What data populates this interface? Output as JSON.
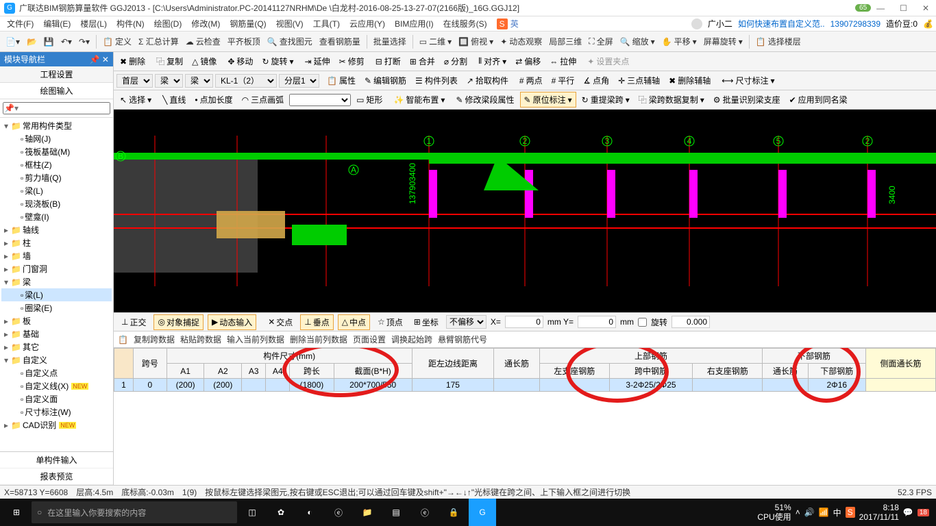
{
  "title": "广联达BIM钢筋算量软件 GGJ2013 - [C:\\Users\\Administrator.PC-20141127NRHM\\De     \\白龙村-2016-08-25-13-27-07(2166版)_16G.GGJ12]",
  "title_badge": "65",
  "win": {
    "min": "—",
    "max": "☐",
    "close": "✕"
  },
  "menu": [
    "文件(F)",
    "编辑(E)",
    "楼层(L)",
    "构件(N)",
    "绘图(D)",
    "修改(M)",
    "钢筋量(Q)",
    "视图(V)",
    "工具(T)",
    "云应用(Y)",
    "BIM应用(I)",
    "在线服务(S)"
  ],
  "menu_right": {
    "user": "广小二",
    "help_link": "如何快速布置自定义范..",
    "phone": "13907298339",
    "coin_label": "造价豆:0"
  },
  "toolbar1": [
    "定义",
    "Σ 汇总计算",
    "云检查",
    "平齐板顶",
    "查找图元",
    "查看钢筋量",
    "批量选择",
    "二维",
    "俯视",
    "动态观察",
    "局部三维",
    "全屏",
    "缩放",
    "平移",
    "屏幕旋转",
    "选择楼层"
  ],
  "toolbar_edit": [
    "删除",
    "复制",
    "镜像",
    "移动",
    "旋转",
    "延伸",
    "修剪",
    "打断",
    "合并",
    "分割",
    "对齐",
    "偏移",
    "拉伸",
    "设置夹点"
  ],
  "combos": {
    "floor": "首层",
    "type": "梁",
    "subtype": "梁",
    "member": "KL-1（2）",
    "layer": "分层1"
  },
  "toolbar_member": [
    "属性",
    "编辑钢筋",
    "构件列表",
    "拾取构件",
    "两点",
    "平行",
    "点角",
    "三点辅轴",
    "删除辅轴",
    "尺寸标注"
  ],
  "toolbar_draw": [
    "选择",
    "直线",
    "点加长度",
    "三点画弧",
    "矩形",
    "智能布置",
    "修改梁段属性",
    "原位标注",
    "重提梁跨",
    "梁跨数据复制",
    "批量识别梁支座",
    "应用到同名梁"
  ],
  "sidebar": {
    "title": "模块导航栏",
    "tabs": [
      "工程设置",
      "绘图输入"
    ],
    "nodes": [
      {
        "label": "常用构件类型",
        "lvl": 0,
        "exp": "-",
        "folder": true
      },
      {
        "label": "轴网(J)",
        "lvl": 1
      },
      {
        "label": "筏板基础(M)",
        "lvl": 1
      },
      {
        "label": "框柱(Z)",
        "lvl": 1
      },
      {
        "label": "剪力墙(Q)",
        "lvl": 1
      },
      {
        "label": "梁(L)",
        "lvl": 1
      },
      {
        "label": "现浇板(B)",
        "lvl": 1
      },
      {
        "label": "壁龛(I)",
        "lvl": 1
      },
      {
        "label": "轴线",
        "lvl": 0,
        "exp": "+",
        "folder": true
      },
      {
        "label": "柱",
        "lvl": 0,
        "exp": "+",
        "folder": true
      },
      {
        "label": "墙",
        "lvl": 0,
        "exp": "+",
        "folder": true
      },
      {
        "label": "门窗洞",
        "lvl": 0,
        "exp": "+",
        "folder": true
      },
      {
        "label": "梁",
        "lvl": 0,
        "exp": "-",
        "folder": true
      },
      {
        "label": "梁(L)",
        "lvl": 1,
        "selected": true
      },
      {
        "label": "圈梁(E)",
        "lvl": 1
      },
      {
        "label": "板",
        "lvl": 0,
        "exp": "+",
        "folder": true
      },
      {
        "label": "基础",
        "lvl": 0,
        "exp": "+",
        "folder": true
      },
      {
        "label": "其它",
        "lvl": 0,
        "exp": "+",
        "folder": true
      },
      {
        "label": "自定义",
        "lvl": 0,
        "exp": "-",
        "folder": true
      },
      {
        "label": "自定义点",
        "lvl": 1
      },
      {
        "label": "自定义线(X)",
        "lvl": 1,
        "new": true
      },
      {
        "label": "自定义面",
        "lvl": 1
      },
      {
        "label": "尺寸标注(W)",
        "lvl": 1
      },
      {
        "label": "CAD识别",
        "lvl": 0,
        "exp": "+",
        "folder": true,
        "new": true
      }
    ],
    "bottom": [
      "单构件输入",
      "报表预览"
    ]
  },
  "snap": {
    "items": [
      "正交",
      "对象捕捉",
      "动态输入",
      "交点",
      "垂点",
      "中点",
      "顶点",
      "坐标"
    ],
    "offset": "不偏移",
    "x_label": "X=",
    "x": "0",
    "y_label": "mm Y=",
    "y": "0",
    "mm": "mm",
    "rotate_label": "旋转",
    "rotate": "0.000"
  },
  "gridbar": [
    "复制跨数据",
    "粘贴跨数据",
    "输入当前列数据",
    "删除当前列数据",
    "页面设置",
    "调换起始跨",
    "悬臂钢筋代号"
  ],
  "grid": {
    "group_headers": [
      "",
      "跨号",
      "构件尺寸(mm)",
      "",
      "上部钢筋",
      "",
      "下部钢筋",
      ""
    ],
    "headers": [
      "",
      "跨号",
      "A1",
      "A2",
      "A3",
      "A4",
      "跨长",
      "截面(B*H)",
      "距左边线距离",
      "通长筋",
      "左支座钢筋",
      "跨中钢筋",
      "右支座钢筋",
      "通长筋",
      "下部钢筋",
      "侧面通长筋"
    ],
    "row": [
      "1",
      "0",
      "(200)",
      "(200)",
      "",
      "",
      "(1800)",
      "200*700/550",
      "175",
      "",
      "",
      "3-2Φ25/2Φ25",
      "",
      "",
      "2Φ16",
      ""
    ]
  },
  "status": {
    "coord": "X=58713 Y=6608",
    "floor": "层高:4.5m",
    "bottom": "底标高:-0.03m",
    "count": "1(9)",
    "hint": "按鼠标左键选择梁图元,按右键或ESC退出;可以通过回车键及shift+\"→←↓↑\"光标键在跨之间、上下输入框之间进行切换",
    "fps": "52.3 FPS"
  },
  "taskbar": {
    "search_placeholder": "在这里输入你要搜索的内容",
    "cpu": "51%",
    "cpu_label": "CPU使用",
    "time": "8:18",
    "date": "2017/11/11",
    "ime": "中",
    "notif": "18"
  }
}
